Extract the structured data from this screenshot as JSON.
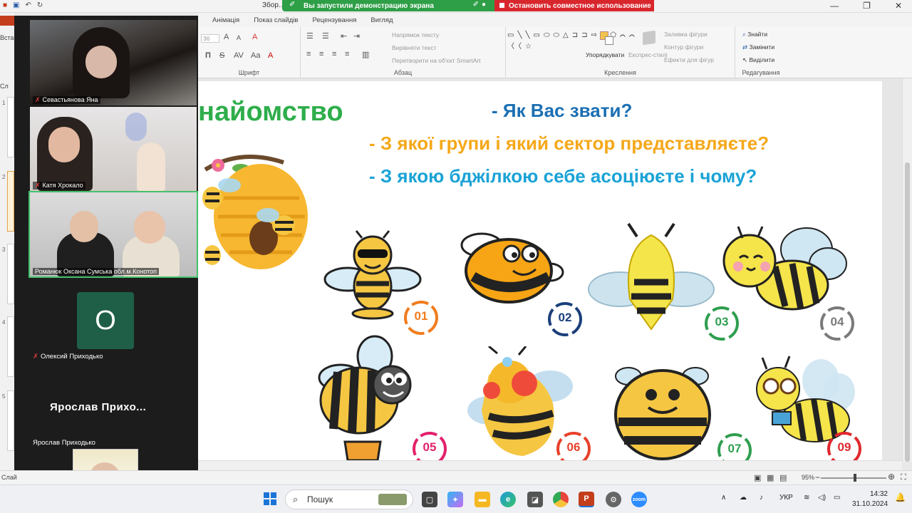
{
  "window": {
    "doc_title": "Збор…",
    "share_banner": "Вы запустили демонстрацию экрана",
    "stop_banner": "Остановить совместное использование"
  },
  "ribbon": {
    "tabs": [
      "Анімація",
      "Показ слайдів",
      "Рецензування",
      "Вигляд"
    ],
    "font_size": "36",
    "groups": {
      "font": "Шрифт",
      "paragraph": "Абзац",
      "drawing": "Креслення",
      "editing": "Редагування"
    },
    "paragraph": {
      "text_direction": "Напрямок тексту",
      "align_text": "Вирівняти текст",
      "smartart": "Перетворити на об'єкт SmartArt"
    },
    "drawing": {
      "arrange": "Упорядкувати",
      "quick_styles": "Експрес-стилі",
      "fill": "Заливка фігури",
      "outline": "Контур фігури",
      "effects": "Ефекти для фігур"
    },
    "editing": {
      "find": "Знайти",
      "replace": "Замінити",
      "select": "Виділити"
    },
    "left_label": "Вста"
  },
  "slide_pane": {
    "numbers": [
      "1",
      "2",
      "3",
      "4",
      "5"
    ],
    "header": "Сл",
    "footer": "Слай"
  },
  "zoom": {
    "participants": [
      {
        "name": "Севастьянова Яна",
        "muted": true
      },
      {
        "name": "Катя Хрокало",
        "muted": true
      },
      {
        "name": "Романюк Оксана Сумська обл.м.Конотоп",
        "muted": false,
        "active": true
      },
      {
        "name": "Олексий Приходько",
        "muted": true,
        "initial": "О"
      },
      {
        "name": "Ярослав  Прихо...",
        "muted": false
      },
      {
        "name": "Ярослав Приходько",
        "muted": false
      }
    ]
  },
  "slide": {
    "title": "найомство",
    "questions": [
      {
        "text": "- Як Вас звати?",
        "color": "#1b6fb3"
      },
      {
        "text": "- З якої групи і який сектор представляєте?",
        "color": "#f5a81a"
      },
      {
        "text": "- З якою бджілкою себе асоціюєте і чому?",
        "color": "#1aa3d6"
      }
    ],
    "badges": [
      {
        "label": "01",
        "color": "#f07c1e"
      },
      {
        "label": "02",
        "color": "#1b3f7a"
      },
      {
        "label": "03",
        "color": "#2f9e4f"
      },
      {
        "label": "04",
        "color": "#7a7a7a"
      },
      {
        "label": "05",
        "color": "#e4206b"
      },
      {
        "label": "06",
        "color": "#e8402a"
      },
      {
        "label": "07",
        "color": "#2f9e4f"
      },
      {
        "label": "09",
        "color": "#e0282d"
      }
    ]
  },
  "statusbar": {
    "zoom": "95%"
  },
  "taskbar": {
    "search_placeholder": "Пошук",
    "lang": "УКР",
    "time": "14:32",
    "date": "31.10.2024"
  },
  "colors": {
    "zoom_panel": "#1c1c1c",
    "share_green": "#2e9e47",
    "stop_red": "#d8262d",
    "title_green": "#2eae4b",
    "active_speaker": "#43c16a"
  }
}
